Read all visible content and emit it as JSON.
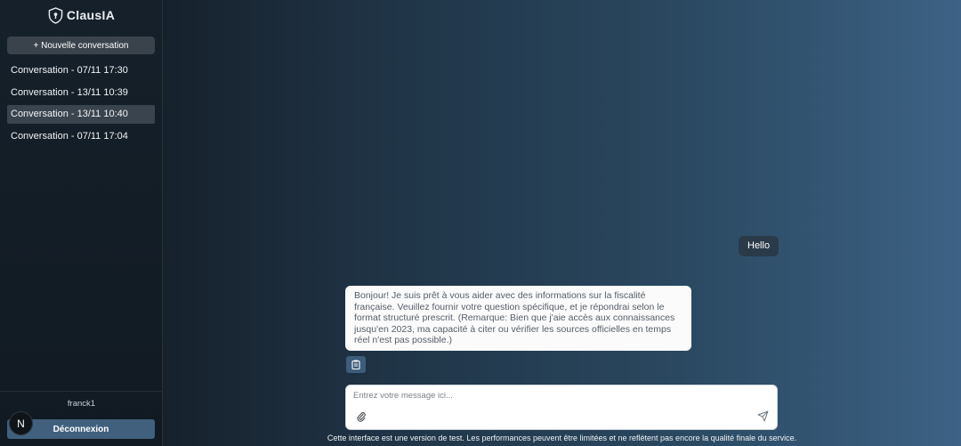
{
  "app": {
    "name": "ClausIA",
    "logo_icon": "shield-icon"
  },
  "sidebar": {
    "new_conversation_label": "+ Nouvelle conversation",
    "conversations": [
      {
        "label": "Conversation - 07/11 17:30",
        "active": false
      },
      {
        "label": "Conversation - 13/11 10:39",
        "active": false
      },
      {
        "label": "Conversation - 13/11 10:40",
        "active": true
      },
      {
        "label": "Conversation - 07/11 17:04",
        "active": false
      }
    ],
    "username": "franck1",
    "avatar_letter": "N",
    "logout_label": "Déconnexion"
  },
  "chat": {
    "messages": [
      {
        "role": "user",
        "text": "Hello"
      },
      {
        "role": "assistant",
        "text": "Bonjour! Je suis prêt à vous aider avec des informations sur la fiscalité française. Veuillez fournir votre question spécifique, et je répondrai selon le format structuré prescrit. (Remarque: Bien que j'aie accès aux connaissances jusqu'en 2023, ma capacité à citer ou vérifier les sources officielles en temps réel n'est pas possible.)"
      }
    ],
    "copy_icon": "clipboard-icon",
    "input": {
      "placeholder": "Entrez votre message ici...",
      "value": ""
    },
    "attach_icon": "paperclip-icon",
    "send_icon": "send-icon"
  },
  "footer": {
    "disclaimer": "Cette interface est une version de test. Les performances peuvent être limitées et ne reflètent pas encore la qualité finale du service."
  },
  "colors": {
    "sidebar_bg": "#131d26",
    "button_bg": "#3a434c",
    "logout_bg": "#40607d",
    "accent": "#3e5d7a"
  }
}
